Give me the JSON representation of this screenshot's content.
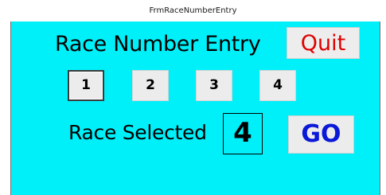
{
  "window": {
    "title": "FrmRaceNumberEntry"
  },
  "form": {
    "heading": "Race Number Entry",
    "quit_label": "Quit",
    "race_buttons": [
      {
        "label": "1",
        "active": true
      },
      {
        "label": "2",
        "active": false
      },
      {
        "label": "3",
        "active": false
      },
      {
        "label": "4",
        "active": false
      }
    ],
    "race_selected_label": "Race Selected",
    "race_selected_value": "4",
    "go_label": "GO"
  },
  "colors": {
    "background": "#00F0FA",
    "quit_text": "#E00000",
    "go_text": "#0A18D8",
    "button_face": "#ECECEC"
  }
}
